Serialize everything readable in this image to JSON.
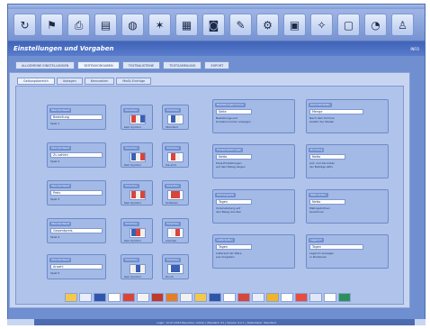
{
  "header": {
    "title": "Einstellungen und Vorgaben",
    "right": "INFO"
  },
  "toolbar": {
    "icons": [
      "refresh-icon",
      "flag-icon",
      "printer-icon",
      "folder-icon",
      "globe-icon",
      "star-icon",
      "box-icon",
      "disk-icon",
      "pen-icon",
      "gear-icon",
      "page-icon",
      "bulb-icon",
      "doc-icon",
      "pie-icon",
      "person-icon"
    ]
  },
  "tabs_top": [
    "ALLGEMEINE EINSTELLUNGEN",
    "SEITENVORGABEN",
    "TEXTBAUSTEINE",
    "TEXTSAMMLUNG",
    "EXPORT"
  ],
  "tabs_sub": [
    "Geltungsbereich",
    "Vorlagen",
    "Kennzahlen",
    "MwSt-Einträge"
  ],
  "left_groups": [
    {
      "label": "Standardwert",
      "value": "Bestellung",
      "sub": "Spiel 1"
    },
    {
      "label": "Standardwert",
      "value": "Zu zahlen",
      "sub": "Spiel 2"
    },
    {
      "label": "Standardwert",
      "value": "Preis",
      "sub": "Spiel 3"
    },
    {
      "label": "Standardwert",
      "value": "Gesamtpreis",
      "sub": "Spiel 4"
    },
    {
      "label": "Standardwert",
      "value": "Anzahl",
      "sub": "Spiel 5"
    }
  ],
  "mid_groups": [
    {
      "label": "Vorschau",
      "sub": "Kein Symbol"
    },
    {
      "label": "Vorschau",
      "sub": "Kein Symbol"
    },
    {
      "label": "Vorschau",
      "sub": "Kein Symbol"
    },
    {
      "label": "Vorschau",
      "sub": "Kein Symbol"
    },
    {
      "label": "Vorschau",
      "sub": "Kein Symbol"
    }
  ],
  "right_groups": [
    {
      "label": "Vorschau",
      "sub": "Standard"
    },
    {
      "label": "Vorschau",
      "sub": "Sie sind"
    },
    {
      "label": "Vorschau",
      "sub": "Sortieren"
    },
    {
      "label": "Vorschau",
      "sub": "Löschen"
    },
    {
      "label": "Vorschau",
      "sub": "Druck"
    }
  ],
  "settings_groups": [
    {
      "label": "Bestellungsnummer",
      "value": "Seite",
      "note1": "Bestellungs-und",
      "note2": "Kundennummer anzeigen"
    },
    {
      "label": "Dezimalstellen",
      "value": "Menge",
      "note1": "Nach dem Komma",
      "note2": "Anzahl der Stellen"
    },
    {
      "label": "Preiseinstellungen",
      "value": "Netto",
      "note1": "Preis-Einstellungen",
      "note2": "auf dem Beleg zeigen"
    },
    {
      "label": "Rundung",
      "value": "Netto",
      "note1": "Auf- und Abrunden",
      "note2": "der Beträge aktiv"
    },
    {
      "label": "Zahlungsziel",
      "value": "Tagen",
      "note1": "Voreinstellung auf",
      "note2": "den Beleg drucken"
    },
    {
      "label": "Mahnstufen",
      "value": "Netto",
      "note1": "Mahngebühren",
      "note2": "berechnen"
    },
    {
      "label": "Lieferzeiten",
      "value": "Tagen",
      "note1": "Lieferzeit der Ware",
      "note2": "aus Vorgaben"
    },
    {
      "label": "Lagerort",
      "value": "Tagen",
      "note1": "Lagerort anzeigen",
      "note2": "in Positionen"
    }
  ],
  "statusbar": {
    "text": "Login: 12.07.2013 Benutzer: Admin | Mandant: 01 | Version 4.2.1 | Datenbank: Standard"
  },
  "colors": {
    "frame": "#6f8fd0",
    "panel": "#c7d5f1",
    "header": "#3f63b7"
  }
}
